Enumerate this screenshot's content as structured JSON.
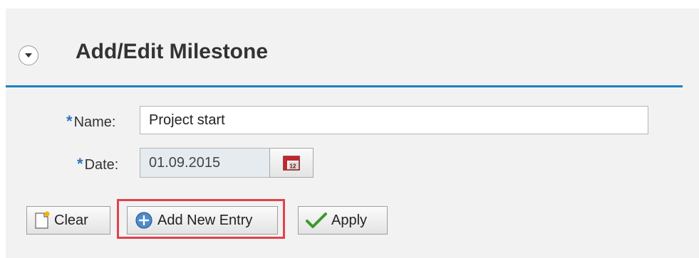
{
  "section": {
    "title": "Add/Edit Milestone",
    "collapse_icon": "chevron-down-icon"
  },
  "form": {
    "required_marker": "*",
    "name_label": "Name:",
    "name_value": "Project start",
    "date_label": "Date:",
    "date_value": "01.09.2015",
    "calendar_icon": "calendar-icon"
  },
  "buttons": {
    "clear_label": "Clear",
    "add_label": "Add New Entry",
    "apply_label": "Apply"
  },
  "colors": {
    "accent_line": "#1f7fc4",
    "required_marker": "#2e74c0",
    "highlight_box": "#e0424b",
    "apply_check": "#3a9a2a"
  }
}
